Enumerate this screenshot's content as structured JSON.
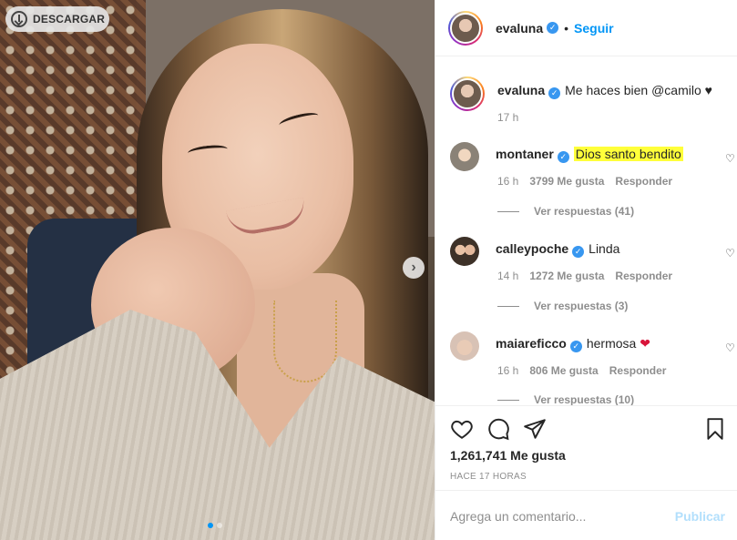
{
  "photo": {
    "download_label": "DESCARGAR",
    "icons": {
      "download": "download-circle-icon",
      "next": "chevron-right-icon"
    },
    "carousel": {
      "count": 2,
      "active_index": 1
    }
  },
  "header": {
    "username": "evaluna",
    "separator": "•",
    "follow_label": "Seguir"
  },
  "caption": {
    "username": "evaluna",
    "text": "Me haces bien @camilo ♥",
    "time": "17 h"
  },
  "comments": [
    {
      "username": "montaner",
      "text": "Dios santo bendito",
      "highlighted": true,
      "time": "16 h",
      "likes": "3799 Me gusta",
      "reply": "Responder",
      "view_replies": "Ver respuestas (41)"
    },
    {
      "username": "calleypoche",
      "text": "Linda",
      "time": "14 h",
      "likes": "1272 Me gusta",
      "reply": "Responder",
      "view_replies": "Ver respuestas (3)"
    },
    {
      "username": "maiareficco",
      "text": "hermosa",
      "emoji": "❤",
      "time": "16 h",
      "likes": "806 Me gusta",
      "reply": "Responder",
      "view_replies": "Ver respuestas (10)"
    }
  ],
  "actions": {
    "icons": [
      "heart-icon",
      "comment-icon",
      "share-icon",
      "bookmark-icon"
    ],
    "likes": "1,261,741 Me gusta",
    "posted": "HACE 17 HORAS"
  },
  "composer": {
    "placeholder": "Agrega un comentario...",
    "publish_label": "Publicar"
  },
  "colors": {
    "accent": "#0095f6",
    "verified": "#3897f0",
    "highlight": "#ffff3a",
    "publish_disabled": "#b2dffc"
  }
}
